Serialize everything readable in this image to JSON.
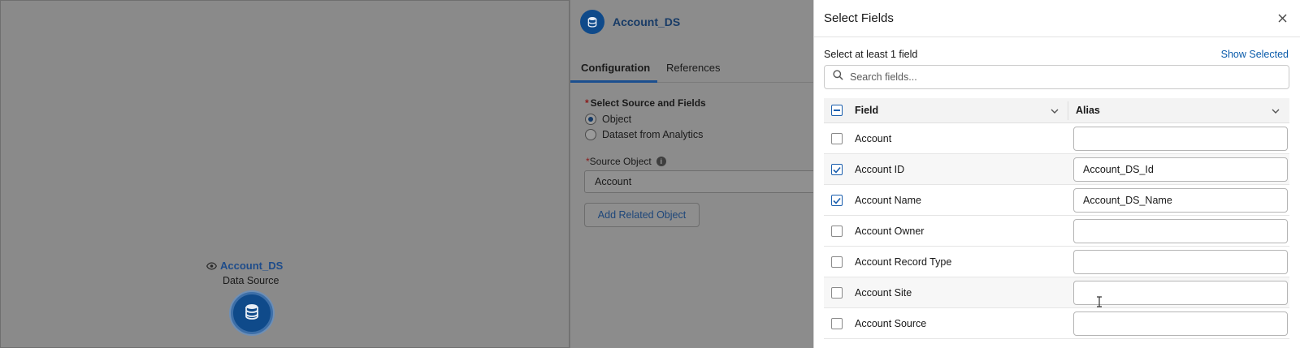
{
  "canvas": {
    "node": {
      "name": "Account_DS",
      "type_label": "Data Source"
    }
  },
  "config": {
    "title": "Account_DS",
    "tabs": [
      {
        "label": "Configuration",
        "active": true
      },
      {
        "label": "References",
        "active": false
      }
    ],
    "source_label": "Select Source and Fields",
    "options": [
      {
        "label": "Object",
        "selected": true
      },
      {
        "label": "Dataset from Analytics",
        "selected": false
      }
    ],
    "source_object_label": "Source Object",
    "source_object_value": "Account",
    "add_related_label": "Add Related Object"
  },
  "modal": {
    "title": "Select Fields",
    "hint": "Select at least 1 field",
    "show_selected_label": "Show Selected",
    "search_placeholder": "Search fields...",
    "columns": {
      "field": "Field",
      "alias": "Alias"
    },
    "rows": [
      {
        "field": "Account",
        "checked": false,
        "alias": ""
      },
      {
        "field": "Account ID",
        "checked": true,
        "alias": "Account_DS_Id"
      },
      {
        "field": "Account Name",
        "checked": true,
        "alias": "Account_DS_Name"
      },
      {
        "field": "Account Owner",
        "checked": false,
        "alias": ""
      },
      {
        "field": "Account Record Type",
        "checked": false,
        "alias": ""
      },
      {
        "field": "Account Site",
        "checked": false,
        "alias": ""
      },
      {
        "field": "Account Source",
        "checked": false,
        "alias": ""
      }
    ]
  },
  "colors": {
    "accent": "#0b5cab",
    "node_blue": "#0f4a8a",
    "overlay_gray": "#8b8b8b"
  }
}
